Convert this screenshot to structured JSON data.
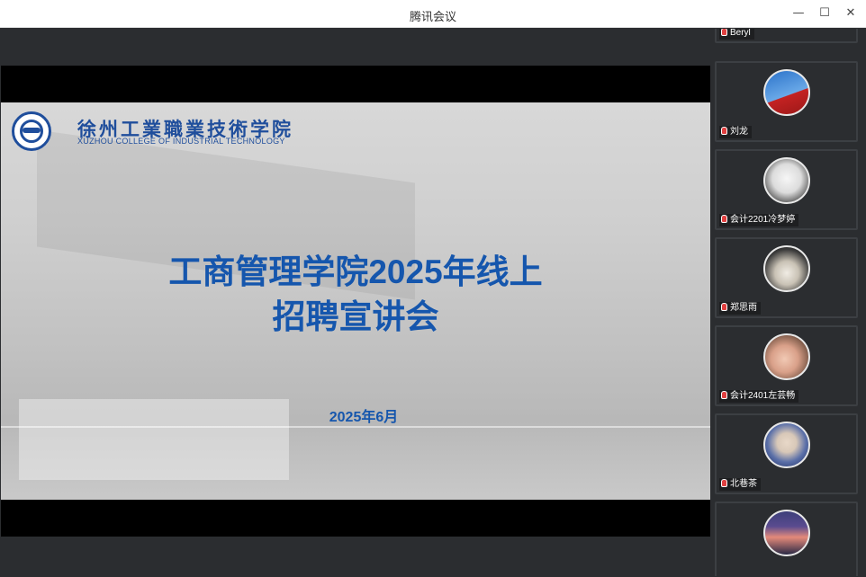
{
  "window": {
    "title": "腾讯会议",
    "min_icon": "—",
    "max_icon": "☐",
    "close_icon": "✕"
  },
  "slide": {
    "school_cn": "徐州工業職業技術学院",
    "school_en": "XUZHOU COLLEGE OF INDUSTRIAL TECHNOLOGY",
    "title_line1": "工商管理学院2025年线上",
    "title_line2": "招聘宣讲会",
    "date": "2025年6月"
  },
  "participants": [
    {
      "name": "Beryl",
      "avatar": "none",
      "mic": "mic-muted-icon"
    },
    {
      "name": "刘龙",
      "avatar": "flag-sky-photo",
      "colors": [
        "#2b72c9",
        "#c42222"
      ]
    },
    {
      "name": "会计2201冷梦婷",
      "avatar": "anime-sketch",
      "colors": [
        "#f2f2f2",
        "#444444"
      ]
    },
    {
      "name": "郑思雨",
      "avatar": "cat-photo",
      "colors": [
        "#c9c2b5",
        "#3a3a3a"
      ]
    },
    {
      "name": "会计2401左芸畅",
      "avatar": "person-photo",
      "colors": [
        "#d9a089",
        "#6b4c3c"
      ]
    },
    {
      "name": "北巷茶",
      "avatar": "portrait-photo",
      "colors": [
        "#1d2a5e",
        "#d8c8b8"
      ]
    },
    {
      "name": "",
      "avatar": "sunset-photo",
      "colors": [
        "#5a4b8f",
        "#e48a7a"
      ]
    }
  ]
}
